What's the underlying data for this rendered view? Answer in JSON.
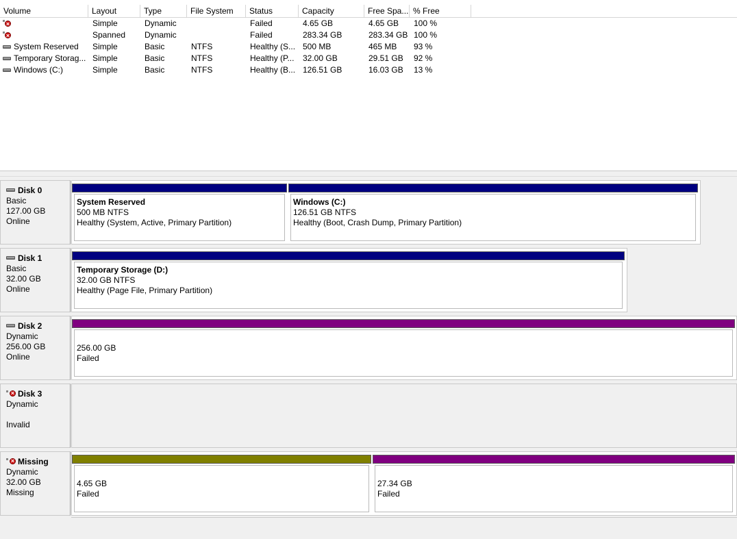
{
  "columns": [
    "Volume",
    "Layout",
    "Type",
    "File System",
    "Status",
    "Capacity",
    "Free Spa...",
    "% Free"
  ],
  "volumes": [
    {
      "icon": "failed-volume-icon",
      "name": "",
      "layout": "Simple",
      "type": "Dynamic",
      "fs": "",
      "status": "Failed",
      "capacity": "4.65 GB",
      "free": "4.65 GB",
      "pct": "100 %"
    },
    {
      "icon": "failed-volume-icon",
      "name": "",
      "layout": "Spanned",
      "type": "Dynamic",
      "fs": "",
      "status": "Failed",
      "capacity": "283.34 GB",
      "free": "283.34 GB",
      "pct": "100 %"
    },
    {
      "icon": "drive-icon",
      "name": "System Reserved",
      "layout": "Simple",
      "type": "Basic",
      "fs": "NTFS",
      "status": "Healthy (S...",
      "capacity": "500 MB",
      "free": "465 MB",
      "pct": "93 %"
    },
    {
      "icon": "drive-icon",
      "name": "Temporary Storag...",
      "layout": "Simple",
      "type": "Basic",
      "fs": "NTFS",
      "status": "Healthy (P...",
      "capacity": "32.00 GB",
      "free": "29.51 GB",
      "pct": "92 %"
    },
    {
      "icon": "drive-icon",
      "name": "Windows (C:)",
      "layout": "Simple",
      "type": "Basic",
      "fs": "NTFS",
      "status": "Healthy (B...",
      "capacity": "126.51 GB",
      "free": "16.03 GB",
      "pct": "13 %"
    }
  ],
  "disks": {
    "d0": {
      "name": "Disk 0",
      "type": "Basic",
      "size": "127.00 GB",
      "state": "Online",
      "p1": {
        "name": "System Reserved",
        "size": "500 MB NTFS",
        "status": "Healthy (System, Active, Primary Partition)"
      },
      "p2": {
        "name": "Windows  (C:)",
        "size": "126.51 GB NTFS",
        "status": "Healthy (Boot, Crash Dump, Primary Partition)"
      }
    },
    "d1": {
      "name": "Disk 1",
      "type": "Basic",
      "size": "32.00 GB",
      "state": "Online",
      "p1": {
        "name": "Temporary Storage  (D:)",
        "size": "32.00 GB NTFS",
        "status": "Healthy (Page File, Primary Partition)"
      }
    },
    "d2": {
      "name": "Disk 2",
      "type": "Dynamic",
      "size": "256.00 GB",
      "state": "Online",
      "p1": {
        "size": "256.00 GB",
        "status": "Failed"
      }
    },
    "d3": {
      "name": "Disk 3",
      "type": "Dynamic",
      "size": "",
      "state": "Invalid"
    },
    "d4": {
      "name": "Missing",
      "type": "Dynamic",
      "size": "32.00 GB",
      "state": "Missing",
      "p1": {
        "size": "4.65 GB",
        "status": "Failed"
      },
      "p2": {
        "size": "27.34 GB",
        "status": "Failed"
      }
    }
  },
  "colors": {
    "primary_partition": "#000080",
    "spanned_volume": "#800080",
    "simple_volume": "#808000"
  }
}
